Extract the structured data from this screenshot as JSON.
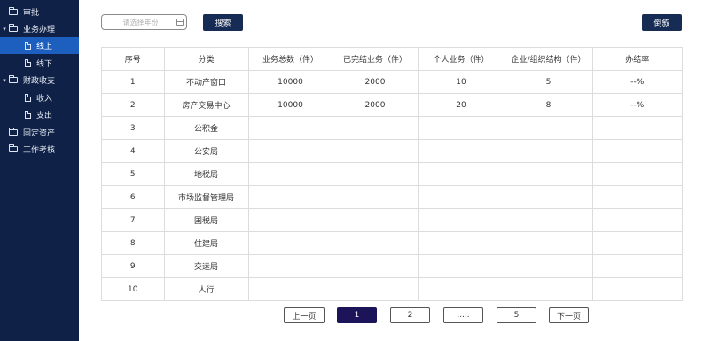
{
  "sidebar": {
    "items": [
      {
        "label": "审批",
        "icon": "folder-icon",
        "caret": ""
      },
      {
        "label": "业务办理",
        "icon": "folder-icon",
        "caret": "▾"
      },
      {
        "label": "线上",
        "icon": "file-icon",
        "caret": ""
      },
      {
        "label": "线下",
        "icon": "file-icon",
        "caret": ""
      },
      {
        "label": "财政收支",
        "icon": "folder-icon",
        "caret": "▾"
      },
      {
        "label": "收入",
        "icon": "file-icon",
        "caret": ""
      },
      {
        "label": "支出",
        "icon": "file-icon",
        "caret": ""
      },
      {
        "label": "固定资产",
        "icon": "folder-icon",
        "caret": ""
      },
      {
        "label": "工作考核",
        "icon": "folder-icon",
        "caret": ""
      }
    ],
    "active_label": "线上"
  },
  "toolbar": {
    "year_placeholder": "请选择年份",
    "search_label": "搜索",
    "reverse_label": "倒叙"
  },
  "table": {
    "headers": [
      "序号",
      "分类",
      "业务总数（件）",
      "已完结业务（件）",
      "个人业务（件）",
      "企业/组织结构（件）",
      "办结率"
    ],
    "rows": [
      [
        "1",
        "不动产窗口",
        "10000",
        "2000",
        "10",
        "5",
        "--%"
      ],
      [
        "2",
        "房产交易中心",
        "10000",
        "2000",
        "20",
        "8",
        "--%"
      ],
      [
        "3",
        "公积金",
        "",
        "",
        "",
        "",
        ""
      ],
      [
        "4",
        "公安局",
        "",
        "",
        "",
        "",
        ""
      ],
      [
        "5",
        "地税局",
        "",
        "",
        "",
        "",
        ""
      ],
      [
        "6",
        "市场监督管理局",
        "",
        "",
        "",
        "",
        ""
      ],
      [
        "7",
        "国税局",
        "",
        "",
        "",
        "",
        ""
      ],
      [
        "8",
        "住建局",
        "",
        "",
        "",
        "",
        ""
      ],
      [
        "9",
        "交运局",
        "",
        "",
        "",
        "",
        ""
      ],
      [
        "10",
        "人行",
        "",
        "",
        "",
        "",
        ""
      ]
    ]
  },
  "pagination": {
    "prev_label": "上一页",
    "pages": [
      "1",
      "2",
      ".....",
      "5"
    ],
    "current": "1",
    "next_label": "下一页"
  },
  "colors": {
    "sidebar_bg": "#0f2146",
    "active_item": "#1c5fbf",
    "button_dark": "#172c55",
    "page_active": "#1b1459"
  }
}
